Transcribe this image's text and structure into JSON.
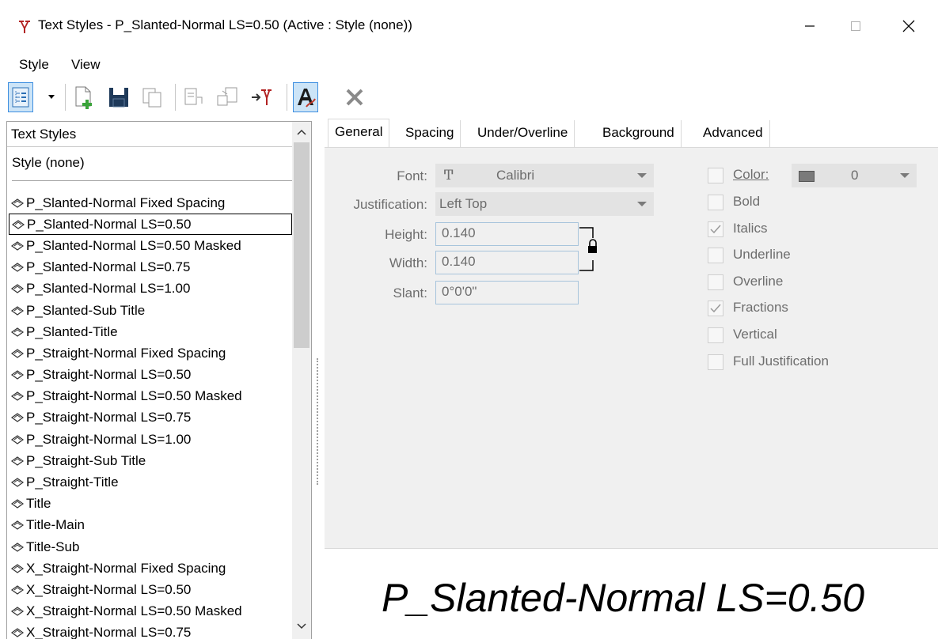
{
  "window": {
    "title": "Text Styles - P_Slanted-Normal LS=0.50 (Active : Style (none))",
    "minimize": "—",
    "maximize": "☐",
    "close": "✕"
  },
  "menu": {
    "items": [
      "Style",
      "View"
    ]
  },
  "toolbar": {
    "icons": [
      "tree-view-icon",
      "dropdown-icon",
      "new-style-icon",
      "save-icon",
      "copy-icon",
      "rename-icon",
      "import-icon",
      "export-icon",
      "text-style-active-icon",
      "delete-icon"
    ]
  },
  "list": {
    "header": "Text Styles",
    "none_item": "Style (none)",
    "selected_index": 1,
    "items": [
      "P_Slanted-Normal Fixed Spacing",
      "P_Slanted-Normal LS=0.50",
      "P_Slanted-Normal LS=0.50 Masked",
      "P_Slanted-Normal LS=0.75",
      "P_Slanted-Normal LS=1.00",
      "P_Slanted-Sub Title",
      "P_Slanted-Title",
      "P_Straight-Normal Fixed Spacing",
      "P_Straight-Normal LS=0.50",
      "P_Straight-Normal LS=0.50 Masked",
      "P_Straight-Normal LS=0.75",
      "P_Straight-Normal LS=1.00",
      "P_Straight-Sub Title",
      "P_Straight-Title",
      "Title",
      "Title-Main",
      "Title-Sub",
      "X_Straight-Normal Fixed Spacing",
      "X_Straight-Normal LS=0.50",
      "X_Straight-Normal LS=0.50 Masked",
      "X_Straight-Normal LS=0.75"
    ]
  },
  "tabs": [
    "General",
    "Spacing",
    "Under/Overline",
    "Background",
    "Advanced"
  ],
  "general": {
    "font_label": "Font:",
    "font_value": "Calibri",
    "font_icon_glyph": "Ͳ",
    "justification_label": "Justification:",
    "justification_value": "Left Top",
    "height_label": "Height:",
    "height_value": "0.140",
    "width_label": "Width:",
    "width_value": "0.140",
    "slant_label": "Slant:",
    "slant_value": "0°0'0\"",
    "color_label": "Color:",
    "color_value": "0",
    "color_swatch": "#7a7a7a",
    "checkboxes": [
      {
        "label": "Bold",
        "checked": false
      },
      {
        "label": "Italics",
        "checked": true
      },
      {
        "label": "Underline",
        "checked": false
      },
      {
        "label": "Overline",
        "checked": false
      },
      {
        "label": "Fractions",
        "checked": true
      },
      {
        "label": "Vertical",
        "checked": false
      },
      {
        "label": "Full Justification",
        "checked": false
      }
    ]
  },
  "preview": {
    "text": "P_Slanted-Normal LS=0.50"
  },
  "colors": {
    "accent": "#3d8ee0",
    "disabled_text": "#6d6d6d",
    "panel_bg": "#f0f0f0"
  }
}
